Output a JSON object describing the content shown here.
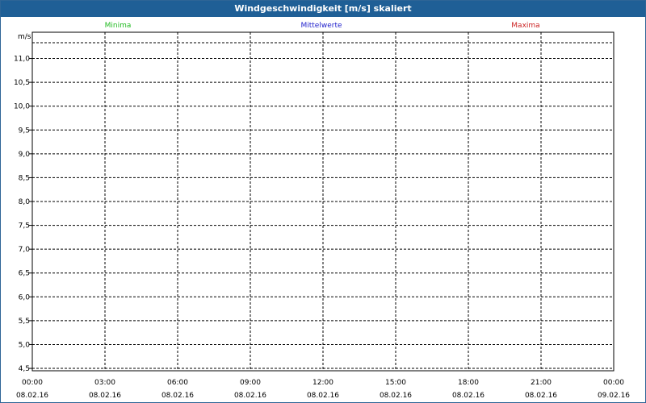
{
  "chart_data": {
    "type": "line",
    "title": "Windgeschwindigkeit [m/s] skaliert",
    "ylabel": "m/s",
    "ylim": [
      4.45,
      11.55
    ],
    "yticks": [
      "4,5",
      "5,0",
      "5,5",
      "6,0",
      "6,5",
      "7,0",
      "7,5",
      "8,0",
      "8,5",
      "9,0",
      "9,5",
      "10,0",
      "10,5",
      "11,0"
    ],
    "ytick_values": [
      4.5,
      5.0,
      5.5,
      6.0,
      6.5,
      7.0,
      7.5,
      8.0,
      8.5,
      9.0,
      9.5,
      10.0,
      10.5,
      11.0
    ],
    "xticks": [
      {
        "time": "00:00",
        "date": "08.02.16"
      },
      {
        "time": "03:00",
        "date": "08.02.16"
      },
      {
        "time": "06:00",
        "date": "08.02.16"
      },
      {
        "time": "09:00",
        "date": "08.02.16"
      },
      {
        "time": "12:00",
        "date": "08.02.16"
      },
      {
        "time": "15:00",
        "date": "08.02.16"
      },
      {
        "time": "18:00",
        "date": "08.02.16"
      },
      {
        "time": "21:00",
        "date": "08.02.16"
      },
      {
        "time": "00:00",
        "date": "09.02.16"
      }
    ],
    "grid": true,
    "legend_placement": "top",
    "series": [
      {
        "name": "Minima",
        "color": "#22bb22",
        "values": []
      },
      {
        "name": "Mittelwerte",
        "color": "#2222cc",
        "values": []
      },
      {
        "name": "Maxima",
        "color": "#cc2222",
        "values": []
      }
    ]
  }
}
